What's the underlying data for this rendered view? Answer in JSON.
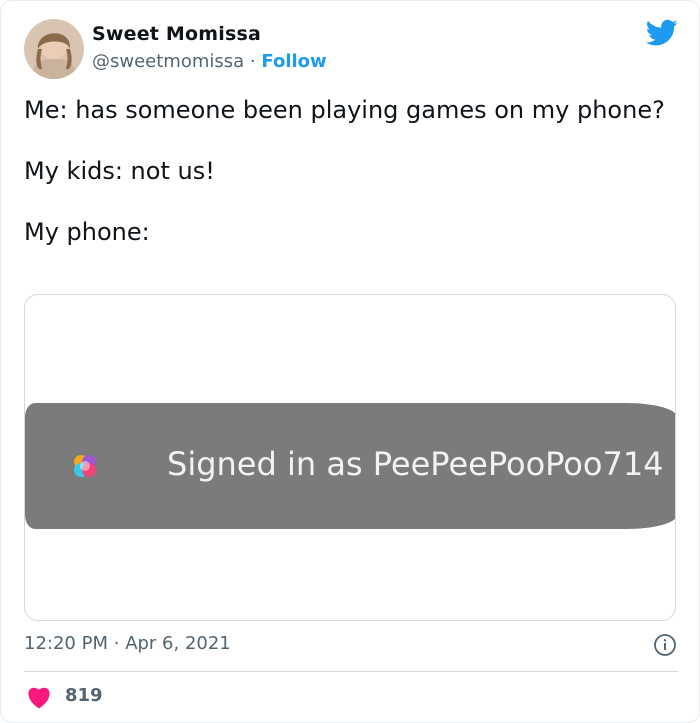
{
  "tweet": {
    "author": {
      "display_name": "Sweet Momissa",
      "handle": "@sweetmomissa",
      "separator": "·",
      "follow_label": "Follow"
    },
    "text": {
      "line1": "Me: has someone been playing games on my phone?",
      "line2": "My kids: not us!",
      "line3": "My phone:"
    },
    "media": {
      "banner_text": "Signed in as PeePeePooPoo714",
      "icon": "game-center-icon"
    },
    "time": "12:20 PM",
    "date": "Apr 6, 2021",
    "meta_separator": "·",
    "like_count": "819"
  },
  "icons": {
    "brand": "twitter-bird-icon",
    "info": "info-icon",
    "like": "heart-icon"
  },
  "colors": {
    "accent": "#1d9bf0",
    "like": "#f91880",
    "banner": "#7b7b7b"
  }
}
